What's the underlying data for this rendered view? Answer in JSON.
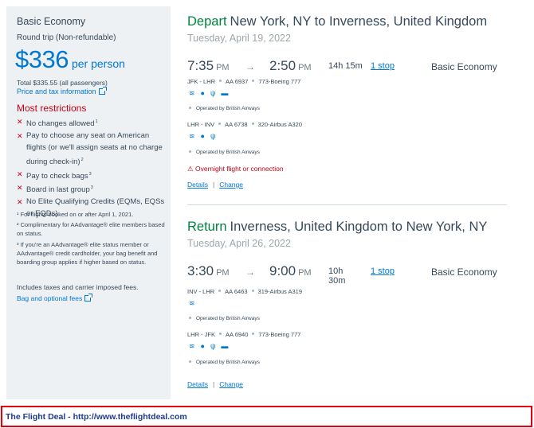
{
  "fare_summary": {
    "fare_type": "Basic Economy",
    "trip_type": "Round trip (Non-refundable)",
    "price": "$336",
    "per_person": "per person",
    "total": "Total $335.55 (all passengers)",
    "price_tax_link": "Price and tax information",
    "restrictions_title": "Most restrictions",
    "restrictions": [
      {
        "text": "No changes allowed",
        "note": "1"
      },
      {
        "text": "Pay to choose any seat on American flights (or we'll assign seats at no charge during check-in)",
        "note": "2"
      },
      {
        "text": "Pay to check bags",
        "note": "3"
      },
      {
        "text": "Board in last group",
        "note": "3"
      },
      {
        "text": "No Elite Qualifying Credits (EQMs, EQSs or EQDs)",
        "note": ""
      }
    ],
    "footnotes": [
      "¹ For flights booked on or after April 1, 2021.",
      "² Complimentary for AAdvantage® elite members based on status.",
      "³ If you're an AAdvantage® elite status member or AAdvantage® credit cardholder, your bag benefit and boarding group applies if higher based on status."
    ],
    "includes": "Includes taxes and carrier imposed fees.",
    "bag_link": "Bag and optional fees"
  },
  "depart": {
    "direction": "Depart",
    "route": "New York, NY to Inverness, United Kingdom",
    "date": "Tuesday, April 19, 2022",
    "dep_time": "7:35",
    "dep_ampm": "PM",
    "arrow": "→",
    "arr_time": "2:50",
    "arr_ampm": "PM",
    "duration": "14h 15m",
    "stops": "1 stop",
    "cabin": "Basic Economy",
    "segments": [
      {
        "route": "JFK - LHR",
        "flight": "AA 6937",
        "aircraft": "773-Boeing 777",
        "operated_by": "Operated by British Airways"
      },
      {
        "route": "LHR - INV",
        "flight": "AA 6738",
        "aircraft": "320-Airbus A320",
        "operated_by": "Operated by British Airways"
      }
    ],
    "warning": "Overnight flight or connection",
    "details_link": "Details",
    "change_link": "Change",
    "link_sep": "|"
  },
  "return": {
    "direction": "Return",
    "route": "Inverness, United Kingdom to New York, NY",
    "date": "Tuesday, April 26, 2022",
    "dep_time": "3:30",
    "dep_ampm": "PM",
    "arrow": "→",
    "arr_time": "9:00",
    "arr_ampm": "PM",
    "duration_h": "10h",
    "duration_m": "30m",
    "stops": "1 stop",
    "cabin": "Basic Economy",
    "segments": [
      {
        "route": "INV - LHR",
        "flight": "AA 6463",
        "aircraft": "319-Airbus A319",
        "operated_by": "Operated by British Airways"
      },
      {
        "route": "LHR - JFK",
        "flight": "AA 6940",
        "aircraft": "773-Boeing 777",
        "operated_by": "Operated by British Airways"
      }
    ],
    "details_link": "Details",
    "change_link": "Change",
    "link_sep": "|"
  },
  "footer": {
    "text": "The Flight Deal - http://www.theflightdeal.com"
  },
  "icons": {
    "wifi": "wifi-icon",
    "power": "power-outlet-icon",
    "usb": "usb-icon",
    "entertainment": "entertainment-screen-icon",
    "warning": "warning-icon",
    "external": "external-link-icon"
  },
  "colors": {
    "brand_blue": "#0078d2",
    "depart_green": "#00853e",
    "restriction_red": "#c30019",
    "text": "#36495a",
    "panel_bg": "#eef1f3",
    "footer_border": "#e3000f",
    "footer_text": "#1e3a8c"
  }
}
